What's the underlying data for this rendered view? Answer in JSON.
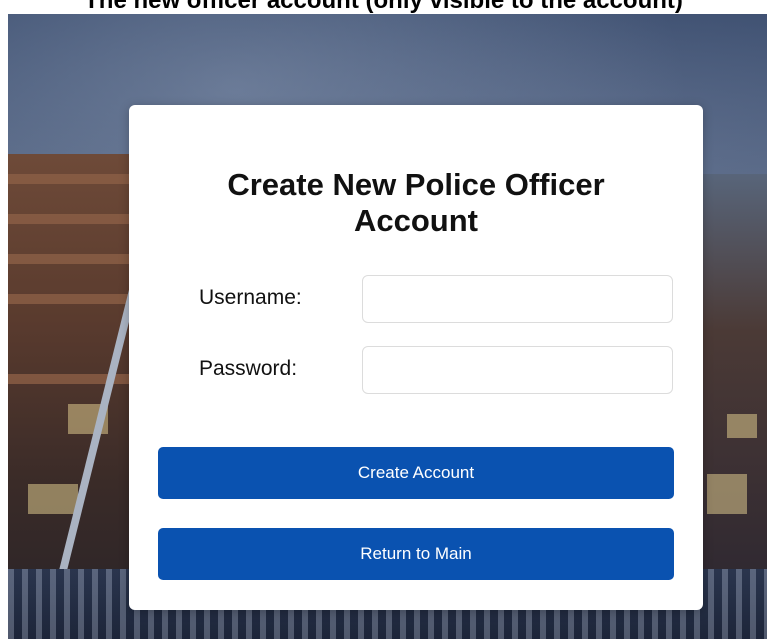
{
  "page": {
    "caption": "The new officer account (only visible to the account)"
  },
  "form": {
    "title": "Create New Police Officer Account",
    "username_label": "Username:",
    "username_value": "",
    "password_label": "Password:",
    "password_value": "",
    "create_button": "Create Account",
    "return_button": "Return to Main"
  },
  "colors": {
    "button_bg": "#0a52b0",
    "button_text": "#ffffff",
    "card_bg": "#ffffff"
  }
}
